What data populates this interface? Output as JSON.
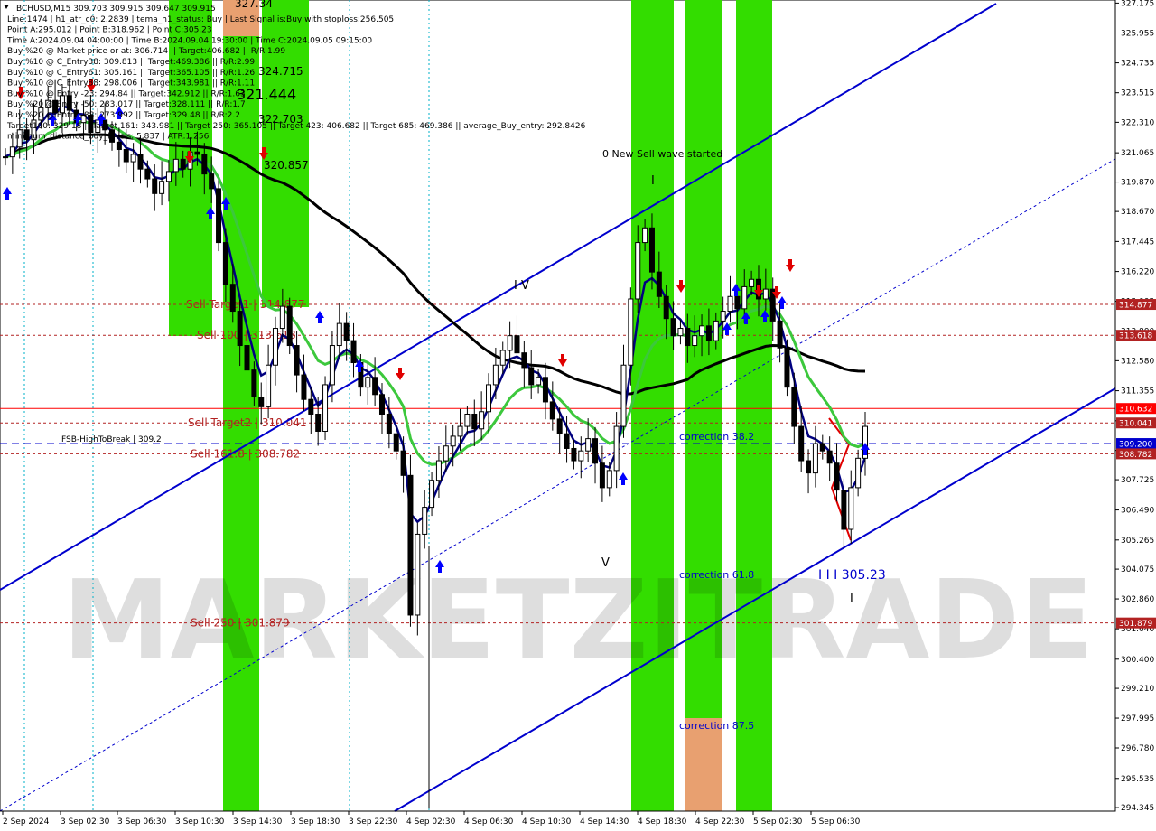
{
  "window": {
    "title": "BCHUSD,M15  309.703 309.915 309.647 309.915"
  },
  "info_lines": [
    "BCHUSD,M15  309.703 309.915 309.647 309.915",
    "Line:1474 | h1_atr_c0: 2.2839 | tema_h1_status: Buy | Last Signal is:Buy with stoploss:256.505",
    "Point A:295.012 | Point B:318.962 | Point C:305.23",
    "Time A:2024.09.04 04:00:00 | Time B:2024.09.04 19:30:00 | Time C:2024.09.05 09:15:00",
    "Buy %20 @ Market price or at: 306.714 || Target:406.682 || R/R:1.99",
    "Buy %10 @ C_Entry38: 309.813 || Target:469.386 || R/R:2.99",
    "Buy %10 @ C_Entry61: 305.161 || Target:365.105 || R/R:1.26",
    "Buy %10 @ C_Entry88: 298.006 || Target:343.981 || R/R:1.11",
    "Buy %10 @ Entry -23: 294.84 || Target:342.912 || R/R:1.63",
    "Buy %20 @ Entry -50: 283.017 || Target:328.111 || R/R:1.7",
    "Buy %20 @ Entry -88: 273.992 || Target:329.48 || R/R:2.2",
    "Target100: 329.18 || Target 161: 343.981 || Target 250: 365.105 || Target 423: 406.682 || Target 685: 469.386 || average_Buy_entry: 292.8426",
    "minimum_distance_buy_levels: 5.837 | ATR:1.256"
  ],
  "watermark": "MARKETZITRADE",
  "colors": {
    "candle": "#000000",
    "tema": "#000080",
    "ma_green": "#3cc83c",
    "ma_black": "#000000",
    "channel": "#0000cd",
    "band_green": "#33dd00",
    "band_orange": "#e8a070",
    "level_red": "#b22222",
    "level_blue": "#0000cd",
    "arrow_blue": "#0000ff",
    "arrow_red": "#e00000"
  },
  "chart_data": {
    "type": "candlestick",
    "symbol": "BCHUSD",
    "timeframe": "M15",
    "ylim": [
      294.2,
      327.3
    ],
    "x_ticks": [
      "2 Sep 2024",
      "3 Sep 02:30",
      "3 Sep 06:30",
      "3 Sep 10:30",
      "3 Sep 14:30",
      "3 Sep 18:30",
      "3 Sep 22:30",
      "4 Sep 02:30",
      "4 Sep 06:30",
      "4 Sep 10:30",
      "4 Sep 14:30",
      "4 Sep 18:30",
      "4 Sep 22:30",
      "5 Sep 02:30",
      "5 Sep 06:30"
    ],
    "y_ticks": [
      "327.175",
      "325.955",
      "324.735",
      "323.515",
      "322.310",
      "321.065",
      "319.870",
      "318.670",
      "317.445",
      "316.220",
      "315.005",
      "313.800",
      "312.580",
      "311.355",
      "310.130",
      "308.920",
      "307.725",
      "306.490",
      "305.265",
      "304.075",
      "302.860",
      "301.640",
      "300.400",
      "299.210",
      "297.995",
      "296.780",
      "295.535",
      "294.345"
    ],
    "price_tags": [
      {
        "label": "314.877",
        "value": 314.877,
        "color": "#b22222"
      },
      {
        "label": "313.618",
        "value": 313.618,
        "color": "#b22222"
      },
      {
        "label": "310.632",
        "value": 310.632,
        "color": "#ff0000"
      },
      {
        "label": "310.041",
        "value": 310.041,
        "color": "#b22222"
      },
      {
        "label": "309.200",
        "value": 309.2,
        "color": "#0000cd"
      },
      {
        "label": "308.782",
        "value": 308.782,
        "color": "#b22222"
      },
      {
        "label": "301.879",
        "value": 301.879,
        "color": "#b22222"
      }
    ],
    "level_labels": [
      {
        "text": "Sell Target1 | 314.877",
        "value": 314.877
      },
      {
        "text": "Sell 100 | 313.618",
        "value": 313.618
      },
      {
        "text": "Sell Target2 | 310.041",
        "value": 310.041
      },
      {
        "text": "Sell 161.8 | 308.782",
        "value": 308.782
      },
      {
        "text": "Sell  250 | 301.879",
        "value": 301.879
      }
    ],
    "fsb_label": "FSB-HighToBreak | 309.2",
    "annotations": [
      {
        "text": "0 New Sell wave started",
        "value": 321.0
      },
      {
        "text": "correction 38.2",
        "value": 309.4
      },
      {
        "text": "correction 61.8",
        "value": 304.0
      },
      {
        "text": "correction 87.5",
        "value": 297.8
      },
      {
        "text": "I I I 305.23",
        "value": 304.0
      },
      {
        "text": "321.444",
        "value": 323.5
      },
      {
        "text": "320.857",
        "value": 320.6
      },
      {
        "text": "324.715",
        "value": 324.7
      },
      {
        "text": "322.703",
        "value": 322.4
      },
      {
        "text": "327.34",
        "value": 327.2
      },
      {
        "text": "V",
        "value": 304.5
      },
      {
        "text": "I",
        "value": 319.9
      },
      {
        "text": "I V",
        "value": 315.9
      }
    ],
    "ohlc_closes": [
      320.9,
      321.3,
      322.0,
      321.6,
      322.4,
      322.9,
      323.2,
      322.7,
      323.4,
      322.8,
      322.3,
      322.6,
      321.9,
      322.4,
      322.0,
      321.5,
      321.2,
      320.7,
      321.0,
      320.4,
      320.0,
      319.4,
      319.9,
      320.3,
      320.8,
      320.4,
      321.1,
      321.0,
      320.2,
      319.6,
      317.4,
      315.7,
      314.6,
      313.2,
      312.2,
      311.1,
      310.7,
      312.4,
      313.9,
      314.8,
      313.2,
      312.0,
      311.0,
      310.4,
      309.7,
      311.6,
      313.2,
      314.1,
      313.4,
      312.5,
      311.5,
      311.9,
      311.2,
      310.4,
      309.6,
      308.9,
      307.9,
      302.2,
      305.5,
      306.6,
      307.7,
      308.5,
      309.1,
      309.5,
      309.9,
      310.4,
      309.8,
      310.5,
      311.6,
      312.4,
      313.0,
      313.6,
      312.9,
      312.3,
      311.6,
      311.9,
      310.9,
      310.2,
      309.6,
      309.0,
      308.5,
      308.9,
      309.4,
      308.4,
      307.4,
      308.1,
      309.9,
      312.4,
      315.1,
      317.4,
      318.0,
      316.2,
      315.2,
      314.3,
      313.6,
      313.9,
      313.2,
      313.6,
      314.0,
      313.4,
      314.2,
      314.6,
      315.2,
      314.7,
      315.6,
      315.9,
      315.1,
      315.5,
      314.2,
      313.1,
      311.5,
      309.9,
      308.5,
      308.0,
      309.2,
      308.9,
      308.4,
      307.3,
      305.7,
      307.4,
      308.6,
      309.9
    ]
  }
}
